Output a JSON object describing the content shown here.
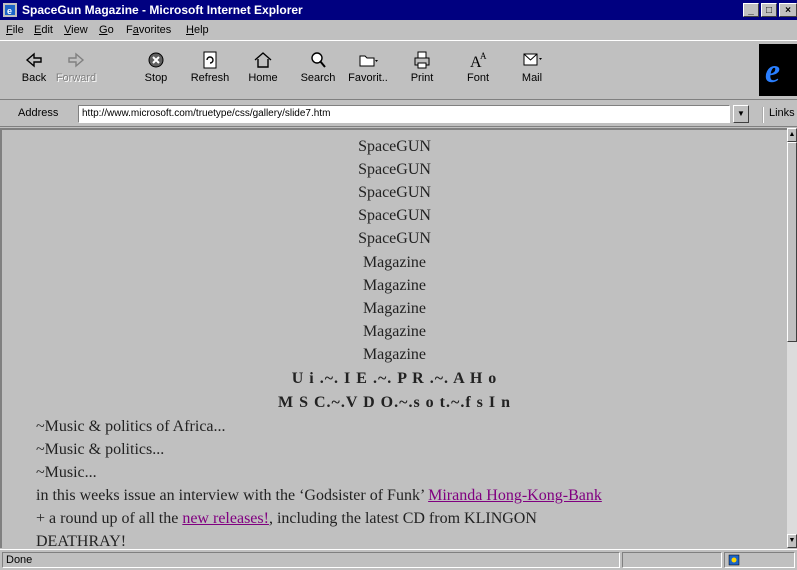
{
  "window": {
    "title": "SpaceGun Magazine - Microsoft Internet Explorer",
    "controls": [
      "_",
      "□",
      "×"
    ]
  },
  "menu": [
    {
      "label": "File",
      "underline": "F"
    },
    {
      "label": "Edit",
      "underline": "E"
    },
    {
      "label": "View",
      "underline": "V"
    },
    {
      "label": "Go",
      "underline": "G"
    },
    {
      "label": "Favorites",
      "underline": "a"
    },
    {
      "label": "Help",
      "underline": "H"
    }
  ],
  "toolbar": {
    "back": "Back",
    "forward": "Forward",
    "stop": "Stop",
    "refresh": "Refresh",
    "home": "Home",
    "search": "Search",
    "favorites": "Favorit..",
    "print": "Print",
    "font": "Font",
    "mail": "Mail"
  },
  "address": {
    "label": "Address",
    "url": "http://www.microsoft.com/truetype/css/gallery/slide7.htm",
    "links": "Links"
  },
  "content": {
    "spacegun_lines": [
      "SpaceGUN",
      "SpaceGUN",
      "SpaceGUN",
      "SpaceGUN",
      "SpaceGUN"
    ],
    "magazine_lines": [
      "Magazine",
      "Magazine",
      "Magazine",
      "Magazine",
      "Magazine"
    ],
    "scrambled_line1": "U i .~. I E .~. P R .~. A H o",
    "scrambled_line2": "M S C.~.V D O.~.s o t.~.f s I n",
    "tagline1": "~Music & politics of Africa...",
    "tagline2": "~Music & politics...",
    "tagline3": "~Music...",
    "interview_prefix": "in this weeks issue an interview with the ‘Godsister of Funk’ ",
    "interview_link": "Miranda Hong-Kong-Bank",
    "roundup_prefix": "+ a round up of all the ",
    "roundup_link": "new releases!",
    "roundup_suffix": ", including the latest CD from KLINGON",
    "deathray": "DEATHRAY!"
  },
  "status": {
    "text": "Done"
  },
  "colors": {
    "titlebar": "#000080",
    "visited_link": "#800080",
    "chrome": "#c0c0c0"
  }
}
